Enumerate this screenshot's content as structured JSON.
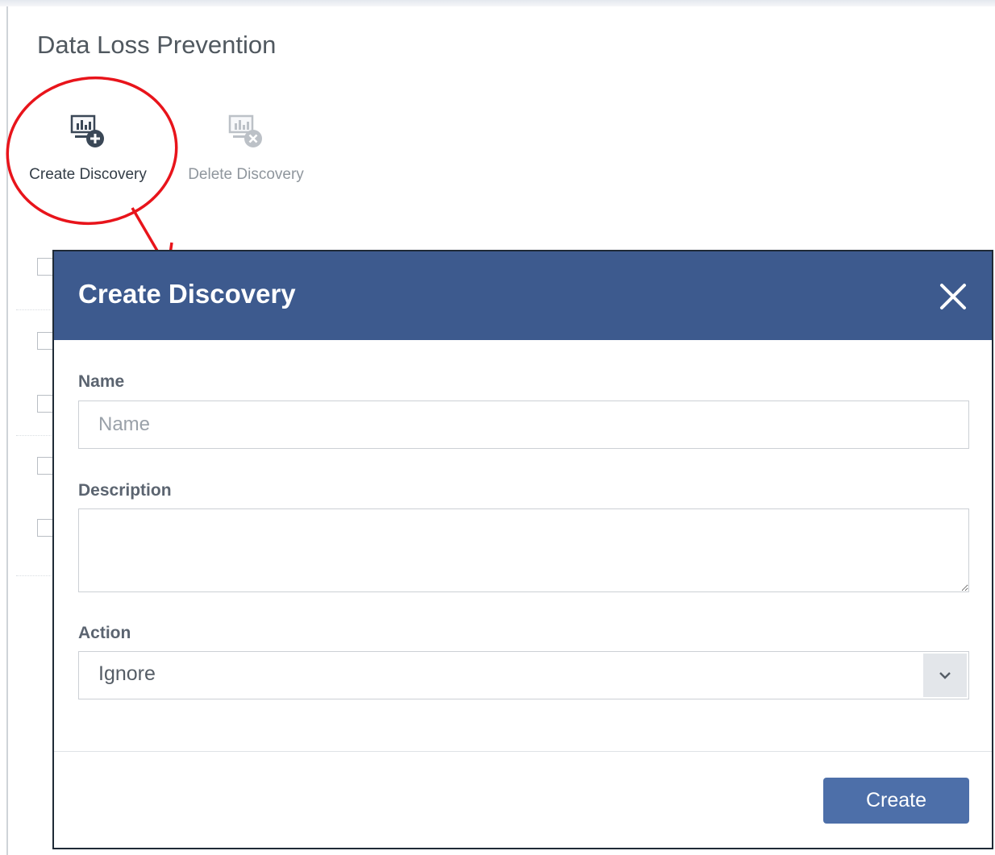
{
  "page": {
    "title": "Data Loss Prevention"
  },
  "toolbar": {
    "create_label": "Create Discovery",
    "delete_label": "Delete Discovery"
  },
  "modal": {
    "title": "Create Discovery",
    "name_label": "Name",
    "name_placeholder": "Name",
    "name_value": "",
    "description_label": "Description",
    "description_value": "",
    "action_label": "Action",
    "action_value": "Ignore",
    "create_button": "Create"
  },
  "colors": {
    "header_bg": "#3d5a8e",
    "button_bg": "#4d6fa9",
    "annotation": "#e8141b"
  },
  "icons": [
    "create-discovery-icon",
    "delete-discovery-icon",
    "close-icon",
    "chevron-down-icon"
  ]
}
